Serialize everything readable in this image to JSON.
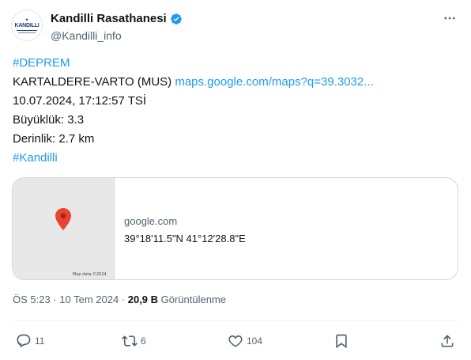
{
  "author": {
    "display_name": "Kandilli Rasathanesi",
    "handle": "@Kandilli_info",
    "verified": true,
    "avatar_text": "KANDILLI"
  },
  "more_icon": "ellipsis-icon",
  "post": {
    "hashtag_top": "#DEPREM",
    "location": "KARTALDERE-VARTO (MUS)",
    "map_link": "maps.google.com/maps?q=39.3032...",
    "datetime": "10.07.2024, 17:12:57 TSİ",
    "magnitude": "Büyüklük: 3.3",
    "depth": "Derinlik: 2.7 km",
    "hashtag_bottom": "#Kandilli"
  },
  "card": {
    "domain": "google.com",
    "coordinates": "39°18'11.5\"N 41°12'28.8\"E",
    "map_credit": "Map data ©2024"
  },
  "meta": {
    "timestamp": "ÖS 5:23 · 10 Tem 2024 · ",
    "views_count": "20,9 B",
    "views_label": " Görüntülenme"
  },
  "actions": {
    "replies": "11",
    "reposts": "6",
    "likes": "104"
  },
  "colors": {
    "link": "#1d9bf0",
    "text": "#0f1419",
    "secondary": "#536471",
    "pin": "#ea4335"
  }
}
